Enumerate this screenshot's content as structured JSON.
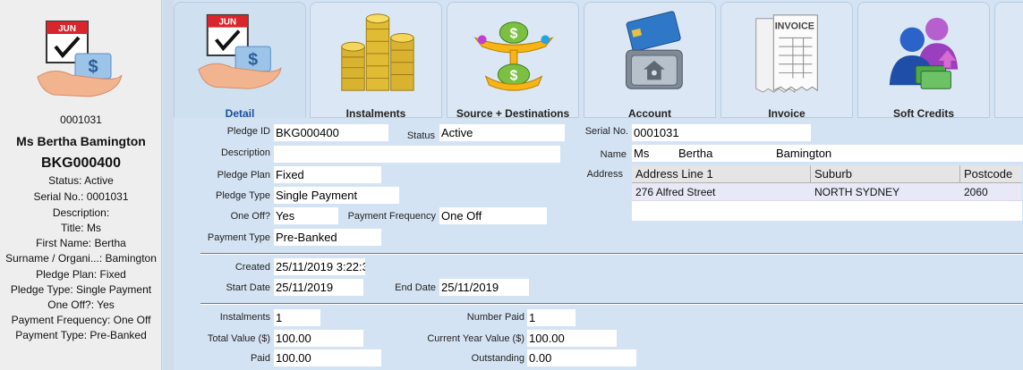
{
  "summary": {
    "serial": "0001031",
    "name": "Ms Bertha Bamington",
    "pledge_id": "BKG000400",
    "lines": [
      "Status: Active",
      "Serial No.: 0001031",
      "Description:",
      "Title: Ms",
      "First Name: Bertha",
      "Surname / Organi...: Bamington",
      "Pledge Plan: Fixed",
      "Pledge Type: Single Payment",
      "One Off?: Yes",
      "Payment Frequency: One Off",
      "Payment Type: Pre-Banked"
    ]
  },
  "tabs": [
    {
      "label": "Detail",
      "icon": "calendar-money-hand-icon"
    },
    {
      "label": "Instalments",
      "icon": "coin-stacks-icon"
    },
    {
      "label": "Source + Destinations",
      "icon": "money-scale-icon"
    },
    {
      "label": "Account",
      "icon": "bank-safe-icon"
    },
    {
      "label": "Invoice",
      "icon": "invoice-icon"
    },
    {
      "label": "Soft Credits",
      "icon": "people-credit-icon"
    }
  ],
  "form": {
    "pledge_id": {
      "label": "Pledge ID",
      "value": "BKG000400"
    },
    "status": {
      "label": "Status",
      "value": "Active"
    },
    "description": {
      "label": "Description",
      "value": ""
    },
    "pledge_plan": {
      "label": "Pledge Plan",
      "value": "Fixed"
    },
    "pledge_type": {
      "label": "Pledge Type",
      "value": "Single Payment"
    },
    "one_off": {
      "label": "One Off?",
      "value": "Yes"
    },
    "payment_frequency": {
      "label": "Payment Frequency",
      "value": "One Off"
    },
    "payment_type": {
      "label": "Payment Type",
      "value": "Pre-Banked"
    },
    "serial_no": {
      "label": "Serial No.",
      "value": "0001031"
    },
    "name": {
      "label": "Name",
      "title": "Ms",
      "first": "Bertha",
      "last": "Bamington"
    },
    "address_label": "Address",
    "address_columns": [
      "Address Line 1",
      "Suburb",
      "Postcode"
    ],
    "address_row": [
      "276 Alfred Street",
      "NORTH SYDNEY",
      "2060"
    ],
    "created": {
      "label": "Created",
      "value": "25/11/2019 3:22:3"
    },
    "start_date": {
      "label": "Start Date",
      "value": "25/11/2019"
    },
    "end_date": {
      "label": "End Date",
      "value": "25/11/2019"
    },
    "instalments": {
      "label": "Instalments",
      "value": "1"
    },
    "number_paid": {
      "label": "Number Paid",
      "value": "1"
    },
    "total_value": {
      "label": "Total Value ($)",
      "value": "100.00"
    },
    "current_year_value": {
      "label": "Current Year Value ($)",
      "value": "100.00"
    },
    "paid": {
      "label": "Paid",
      "value": "100.00"
    },
    "outstanding": {
      "label": "Outstanding",
      "value": "0.00"
    }
  }
}
